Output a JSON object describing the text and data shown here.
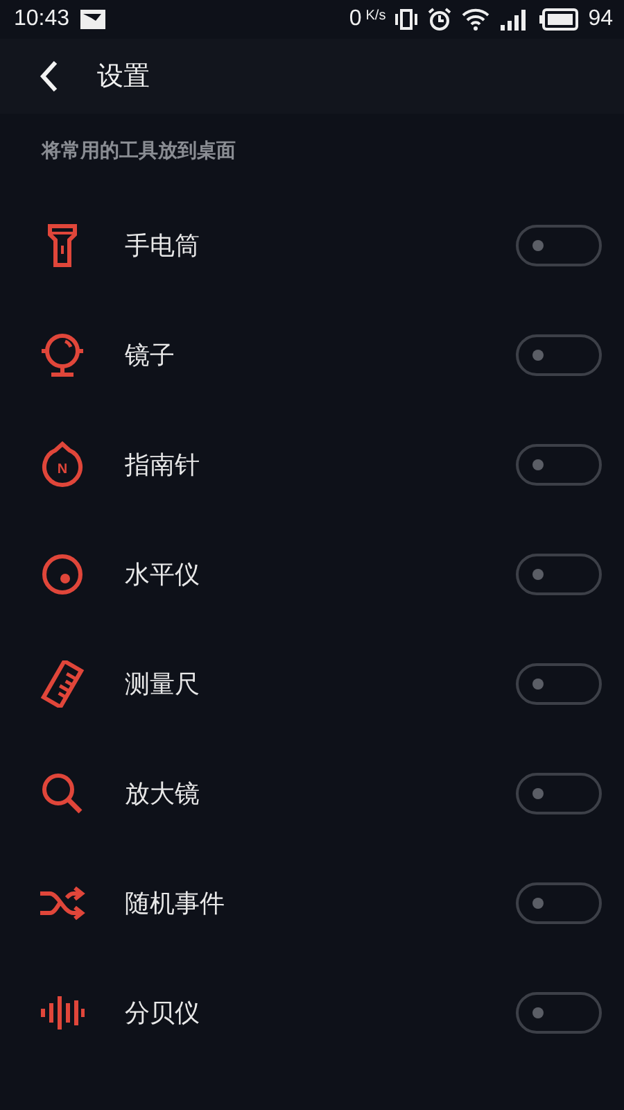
{
  "status_bar": {
    "time": "10:43",
    "speed": "0",
    "speed_unit": "K/s",
    "battery": "94"
  },
  "header": {
    "title": "设置"
  },
  "section": {
    "label": "将常用的工具放到桌面"
  },
  "tools": [
    {
      "kind": "flashlight",
      "label": "手电筒",
      "on": false
    },
    {
      "kind": "mirror",
      "label": "镜子",
      "on": false
    },
    {
      "kind": "compass",
      "label": "指南针",
      "compass_letter": "N",
      "on": false
    },
    {
      "kind": "level",
      "label": "水平仪",
      "on": false
    },
    {
      "kind": "ruler",
      "label": "测量尺",
      "on": false
    },
    {
      "kind": "magnifier",
      "label": "放大镜",
      "on": false
    },
    {
      "kind": "random",
      "label": "随机事件",
      "on": false
    },
    {
      "kind": "decibel",
      "label": "分贝仪",
      "on": false
    }
  ]
}
